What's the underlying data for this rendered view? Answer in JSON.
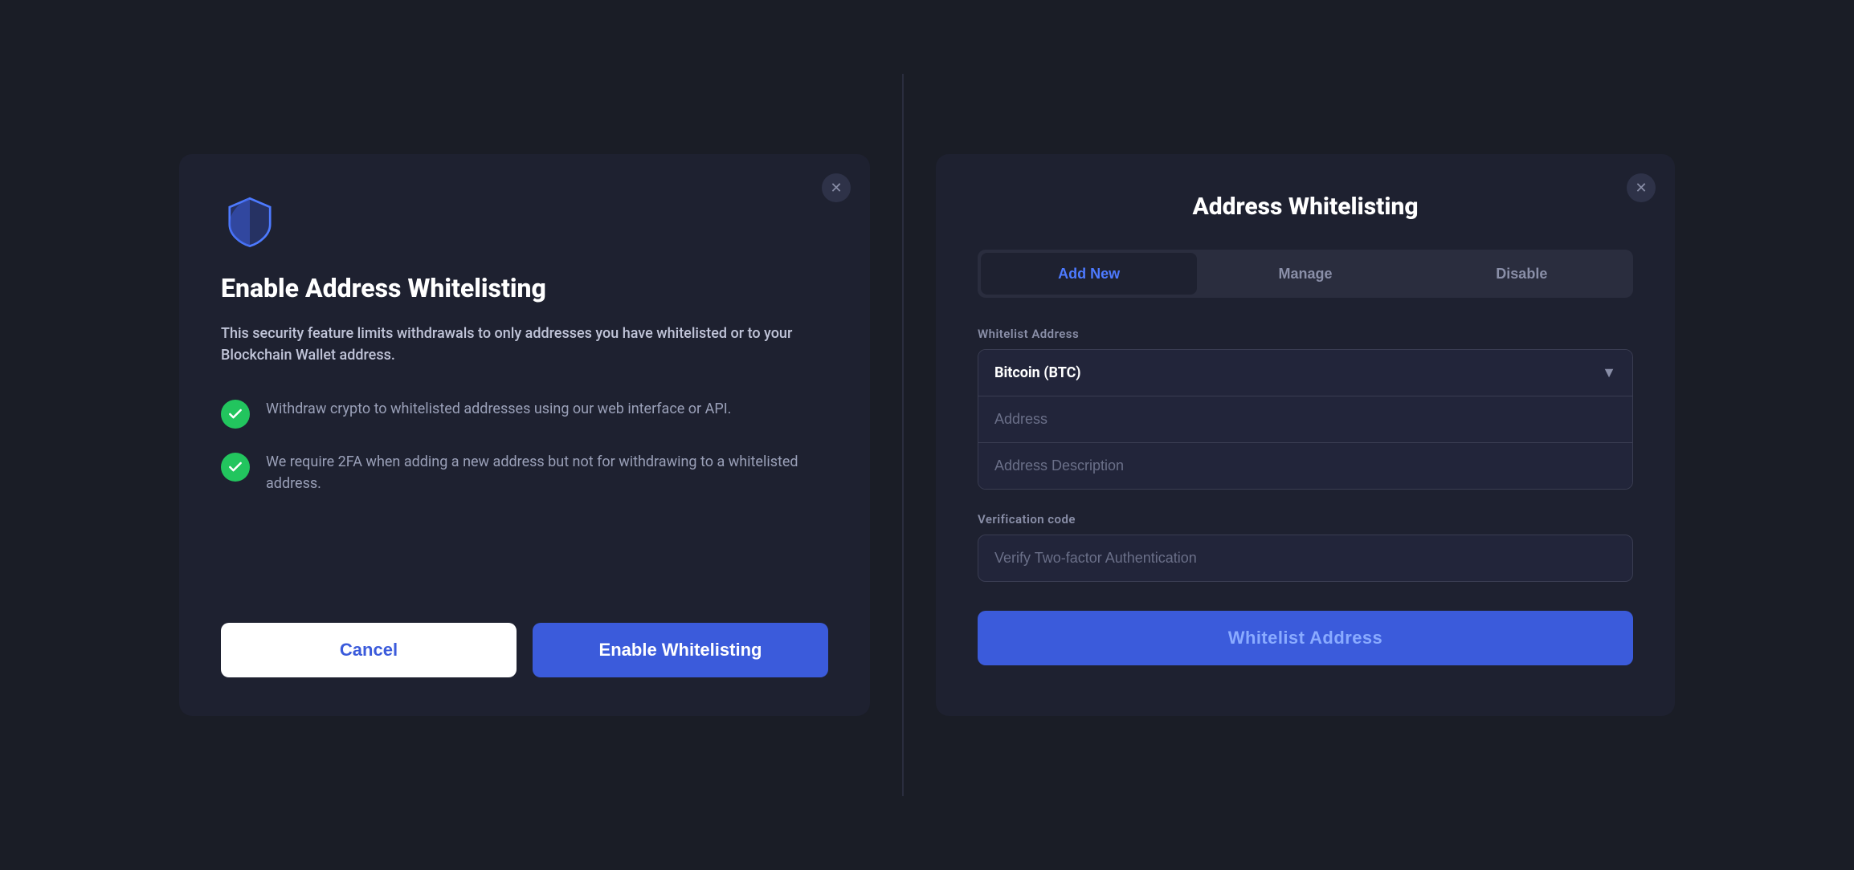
{
  "left": {
    "title": "Enable Address Whitelisting",
    "description": "This security feature limits withdrawals to only addresses you have whitelisted or to your Blockchain Wallet address.",
    "features": [
      {
        "text": "Withdraw crypto to whitelisted addresses using our web interface or API."
      },
      {
        "text": "We require 2FA when adding a new address but not for withdrawing to a whitelisted address."
      }
    ],
    "cancel_label": "Cancel",
    "enable_label": "Enable Whitelisting"
  },
  "right": {
    "title": "Address Whitelisting",
    "tabs": [
      {
        "label": "Add New",
        "active": true
      },
      {
        "label": "Manage",
        "active": false
      },
      {
        "label": "Disable",
        "active": false
      }
    ],
    "whitelist_address_label": "Whitelist Address",
    "currency_selected": "Bitcoin (BTC)",
    "address_placeholder": "Address",
    "address_description_placeholder": "Address Description",
    "verification_label": "Verification code",
    "verification_placeholder": "Verify Two-factor Authentication",
    "submit_label": "Whitelist Address"
  }
}
